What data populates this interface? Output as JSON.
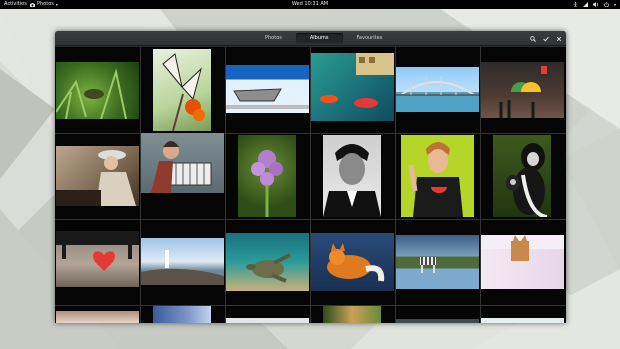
{
  "topbar": {
    "activities": "Activities",
    "app_menu": "Photos",
    "clock": "Wed 10:31 AM",
    "icons": [
      "accessibility-icon",
      "network-icon",
      "volume-icon",
      "power-icon"
    ]
  },
  "window": {
    "tabs": [
      {
        "label": "Photos",
        "active": false
      },
      {
        "label": "Albums",
        "active": true
      },
      {
        "label": "Favourites",
        "active": false
      }
    ],
    "buttons": [
      "search-icon",
      "select-check-icon",
      "close-icon"
    ]
  },
  "photos": [
    {
      "name": "photo-grass-frog"
    },
    {
      "name": "photo-butterfly"
    },
    {
      "name": "photo-boat-shore"
    },
    {
      "name": "photo-harbor-boats"
    },
    {
      "name": "photo-bridge"
    },
    {
      "name": "photo-rainy-street"
    },
    {
      "name": "photo-chess-player"
    },
    {
      "name": "photo-accordion-player"
    },
    {
      "name": "photo-purple-orchid"
    },
    {
      "name": "photo-portrait-man"
    },
    {
      "name": "photo-boy-watermelon"
    },
    {
      "name": "photo-monkeys"
    },
    {
      "name": "photo-red-heart"
    },
    {
      "name": "photo-lighthouse"
    },
    {
      "name": "photo-sea-turtle"
    },
    {
      "name": "photo-sleeping-fox"
    },
    {
      "name": "photo-zebra-lake"
    },
    {
      "name": "photo-cat-wall"
    },
    {
      "name": "photo-row4-1"
    },
    {
      "name": "photo-row4-2"
    },
    {
      "name": "photo-row4-3"
    },
    {
      "name": "photo-row4-4"
    },
    {
      "name": "photo-row4-5"
    },
    {
      "name": "photo-row4-6"
    }
  ]
}
